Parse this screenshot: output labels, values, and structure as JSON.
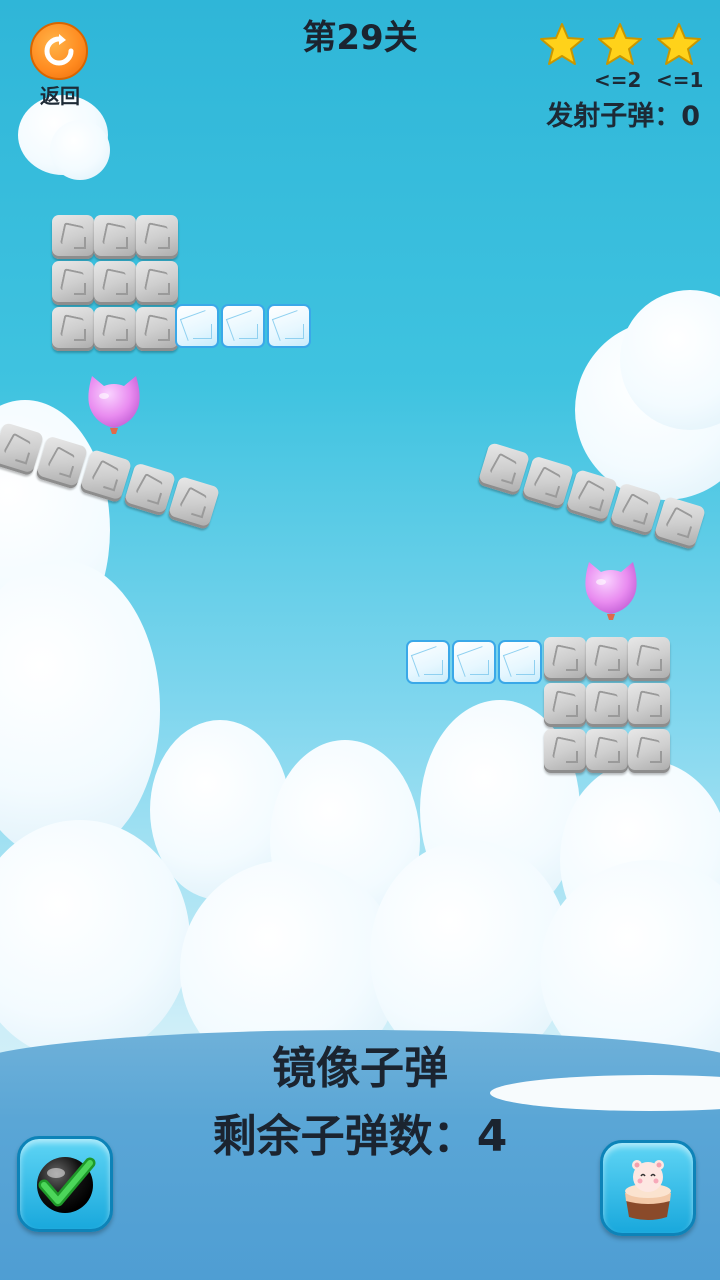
{
  "header": {
    "back_label": "返回",
    "level_title": "第29关",
    "stars": [
      {
        "condition": ""
      },
      {
        "condition": "<=2"
      },
      {
        "condition": "<=1"
      }
    ],
    "shots_label": "发射子弹：",
    "shots_value": "0"
  },
  "footer": {
    "bullet_type": "镜像子弹",
    "remaining_label": "剩余子弹数：",
    "remaining_value": "4"
  },
  "colors": {
    "sky": "#3fc3e0",
    "star": "#ffd21a",
    "balloon": "#e98cf0",
    "back_button": "#ff8a1f",
    "ice_border": "#3aa8e8"
  },
  "icons": [
    "refresh-icon",
    "star-icon",
    "balloon-icon",
    "confirm-check-icon",
    "cake-icon"
  ]
}
